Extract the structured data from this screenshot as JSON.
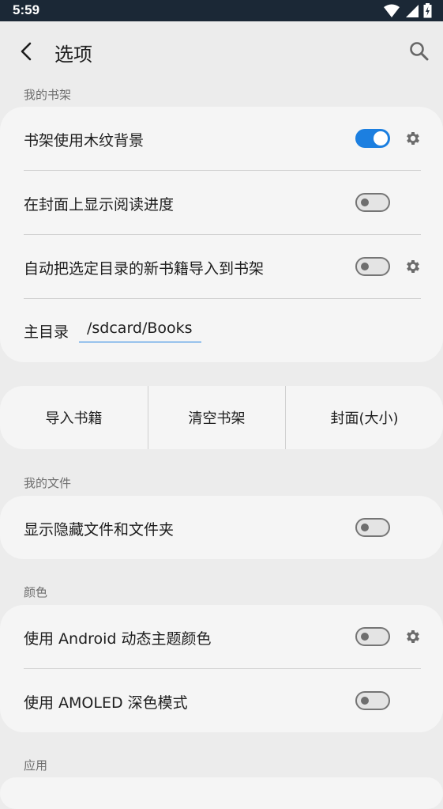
{
  "status_bar": {
    "time": "5:59"
  },
  "toolbar": {
    "title": "选项"
  },
  "sections": {
    "bookshelf": {
      "header": "我的书架",
      "wood_background": {
        "label": "书架使用木纹背景",
        "enabled": true
      },
      "reading_progress": {
        "label": "在封面上显示阅读进度",
        "enabled": false
      },
      "auto_import": {
        "label": "自动把选定目录的新书籍导入到书架",
        "enabled": false
      },
      "main_dir": {
        "label": "主目录",
        "value": "/sdcard/Books"
      }
    },
    "actions": {
      "import": "导入书籍",
      "clear": "清空书架",
      "cover": "封面(大小)"
    },
    "files": {
      "header": "我的文件",
      "show_hidden": {
        "label": "显示隐藏文件和文件夹",
        "enabled": false
      }
    },
    "colors": {
      "header": "颜色",
      "dynamic_theme": {
        "label": "使用 Android 动态主题颜色",
        "enabled": false
      },
      "amoled": {
        "label": "使用 AMOLED 深色模式",
        "enabled": false
      }
    },
    "app": {
      "header": "应用"
    }
  },
  "colors": {
    "accent": "#1c7fe0",
    "card": "#f5f5f5",
    "background": "#ececec",
    "status_bar": "#1b2836"
  }
}
